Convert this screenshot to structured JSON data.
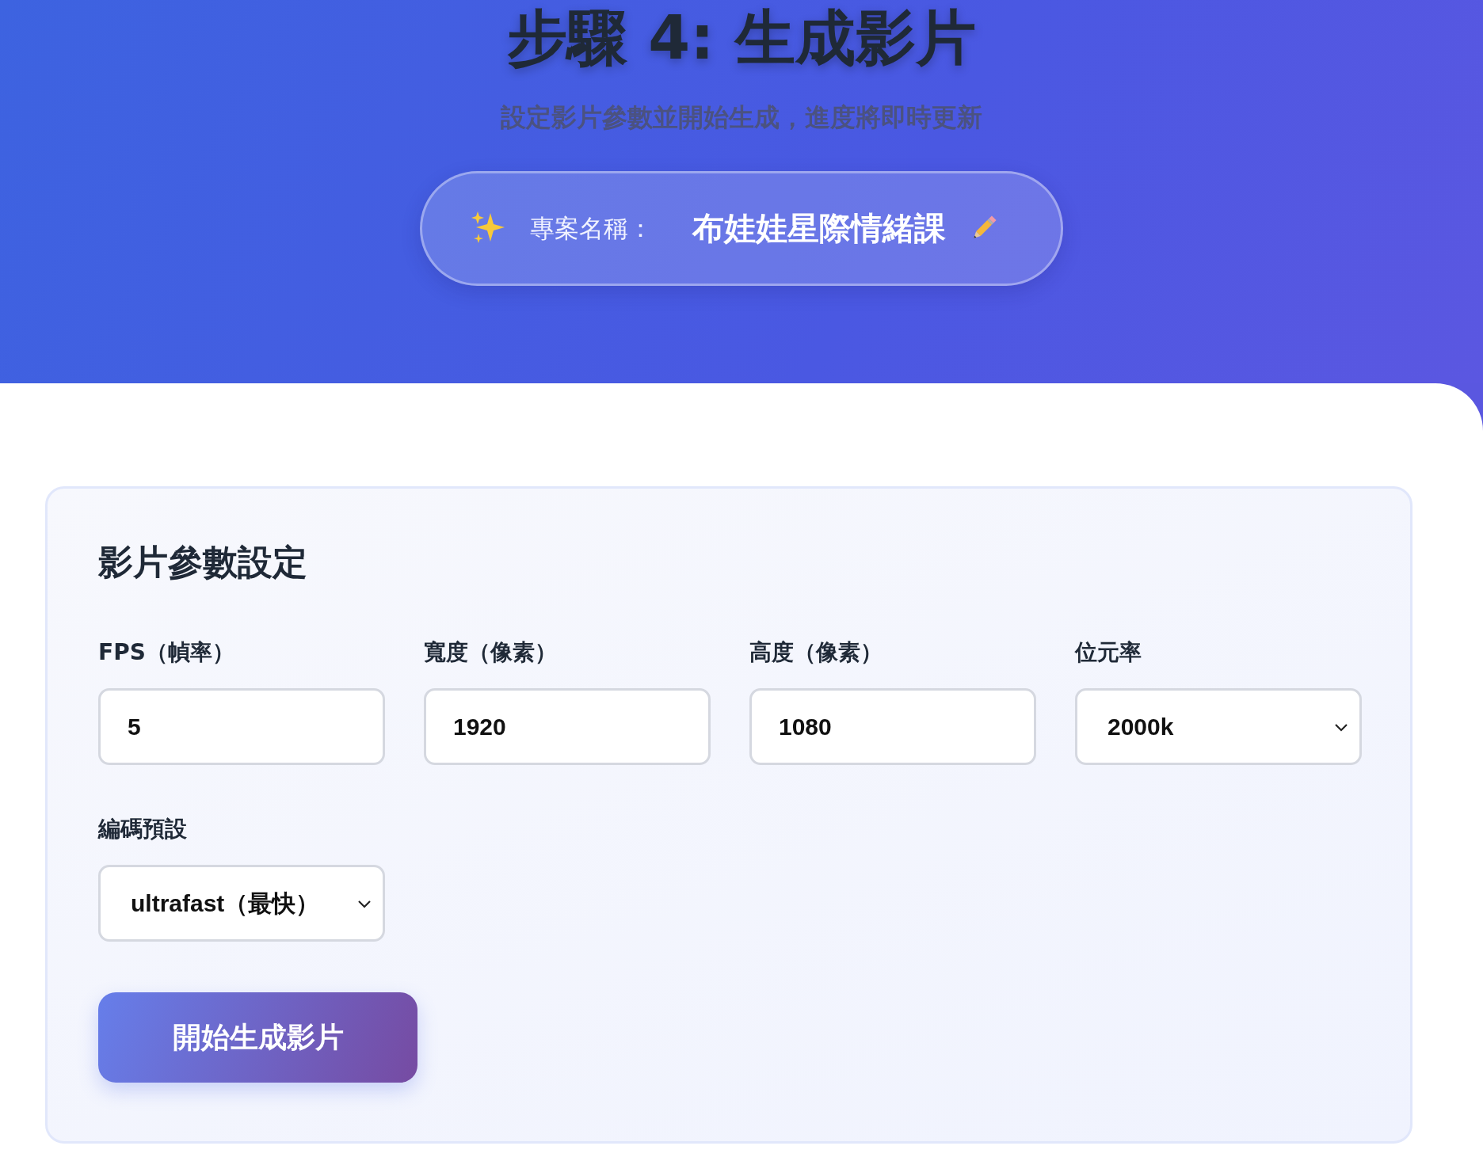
{
  "header": {
    "title": "步驟 4: 生成影片",
    "subtitle": "設定影片參數並開始生成，進度將即時更新",
    "project": {
      "label": "專案名稱：",
      "name": "布娃娃星際情緒課"
    }
  },
  "settings": {
    "title": "影片參數設定",
    "fields": [
      {
        "kind": "input",
        "label": "FPS（幀率）",
        "value": "5"
      },
      {
        "kind": "input",
        "label": "寬度（像素）",
        "value": "1920"
      },
      {
        "kind": "input",
        "label": "高度（像素）",
        "value": "1080"
      },
      {
        "kind": "select",
        "label": "位元率",
        "value": "2000k"
      },
      {
        "kind": "select",
        "label": "編碼預設",
        "value": "ultrafast（最快）"
      }
    ],
    "button": "開始生成影片"
  }
}
